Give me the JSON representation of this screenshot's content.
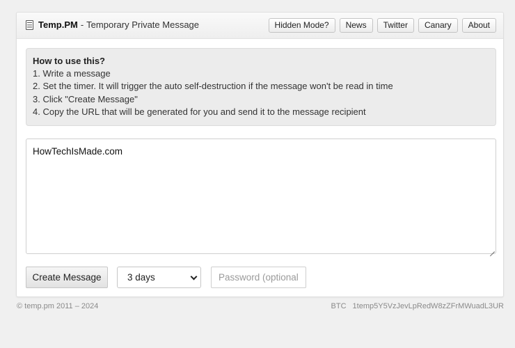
{
  "header": {
    "brand_name": "Temp.PM",
    "brand_separator": "-",
    "tagline": "Temporary Private Message",
    "nav": [
      "Hidden Mode?",
      "News",
      "Twitter",
      "Canary",
      "About"
    ]
  },
  "info": {
    "title": "How to use this?",
    "steps": [
      "1. Write a message",
      "2. Set the timer. It will trigger the auto self-destruction if the message won't be read in time",
      "3. Click \"Create Message\"",
      "4. Copy the URL that will be generated for you and send it to the message recipient"
    ]
  },
  "message": {
    "value": "HowTechIsMade.com"
  },
  "controls": {
    "create_label": "Create Message",
    "timer_selected": "3 days",
    "password_placeholder": "Password (optional)"
  },
  "footer": {
    "copyright": "© temp.pm 2011 – 2024",
    "btc_label": "BTC",
    "btc_address": "1temp5Y5VzJevLpRedW8zZFrMWuadL3UR"
  },
  "icons": {
    "brand": "document-icon",
    "select": "chevron-down-icon"
  },
  "colors": {
    "background": "#f0f0f0",
    "card": "#ffffff",
    "info_panel": "#ececec",
    "footer_text": "#8a8a8a"
  }
}
